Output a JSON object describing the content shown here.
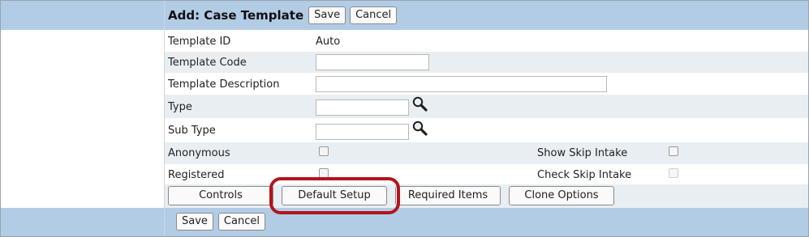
{
  "header": {
    "title": "Add: Case Template",
    "save_label": "Save",
    "cancel_label": "Cancel"
  },
  "fields": {
    "template_id": {
      "label": "Template ID",
      "value": "Auto"
    },
    "template_code": {
      "label": "Template Code",
      "value": ""
    },
    "template_description": {
      "label": "Template Description",
      "value": ""
    },
    "type": {
      "label": "Type",
      "value": ""
    },
    "sub_type": {
      "label": "Sub Type",
      "value": ""
    },
    "anonymous": {
      "label": "Anonymous",
      "checked": false
    },
    "show_skip_intake": {
      "label": "Show Skip Intake",
      "checked": false
    },
    "registered": {
      "label": "Registered",
      "checked": false
    },
    "check_skip_intake": {
      "label": "Check Skip Intake",
      "checked": false,
      "disabled": true
    }
  },
  "tabs": {
    "controls": "Controls",
    "default_setup": "Default Setup",
    "required_items": "Required Items",
    "clone_options": "Clone Options"
  },
  "footer": {
    "save_label": "Save",
    "cancel_label": "Cancel"
  },
  "colors": {
    "band": "#b2cce6",
    "row_alt": "#e9eef3",
    "highlight": "#b3141b"
  },
  "icons": {
    "lookup": "magnifier-icon"
  }
}
